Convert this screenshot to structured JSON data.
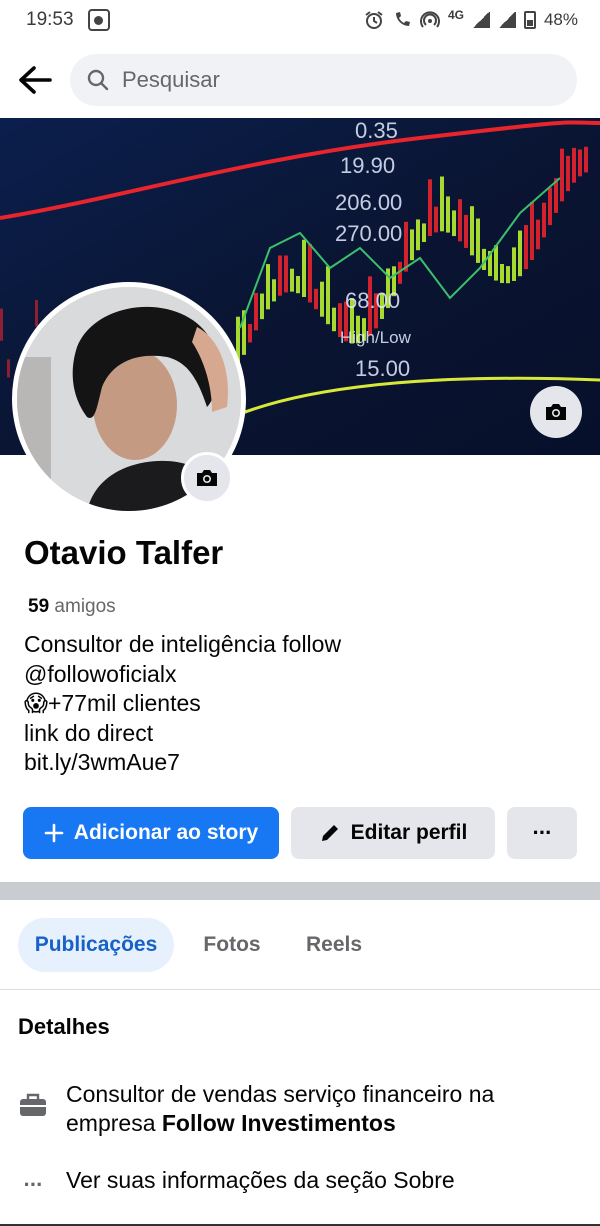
{
  "status_bar": {
    "time": "19:53",
    "network": "4G",
    "battery": "48%",
    "icons": [
      "screen-record-icon",
      "alarm-icon",
      "volte-icon",
      "hotspot-icon",
      "signal-icon",
      "battery-icon"
    ]
  },
  "search": {
    "placeholder": "Pesquisar",
    "value": ""
  },
  "cover": {
    "ticker_values": [
      "0.35",
      "19.90",
      "206.00",
      "270.00",
      "68.00",
      "High/Low",
      "15.00"
    ],
    "colors": {
      "bull": "#b8f030",
      "bear": "#e8242c",
      "background": "#0a1a3a"
    }
  },
  "profile": {
    "name": "Otavio Talfer",
    "friends_count": "59",
    "friends_label": "amigos",
    "bio_lines": [
      "Consultor de inteligência follow",
      "@followoficialx",
      "😱+77mil clientes",
      "link do direct",
      "bit.ly/3wmAue7"
    ]
  },
  "actions": {
    "add_story": "Adicionar ao story",
    "edit_profile": "Editar perfil",
    "more": "···"
  },
  "tabs": [
    {
      "label": "Publicações",
      "active": true
    },
    {
      "label": "Fotos",
      "active": false
    },
    {
      "label": "Reels",
      "active": false
    }
  ],
  "details": {
    "title": "Detalhes",
    "work_prefix": "Consultor de vendas serviço financeiro na empresa",
    "work_company": "Follow Investimentos",
    "about_link": "Ver suas informações da seção Sobre"
  },
  "colors": {
    "primary": "#1877f2",
    "secondary_button": "#e4e6eb",
    "tab_active_bg": "#e7f0fd",
    "tab_active_text": "#1762c7"
  }
}
